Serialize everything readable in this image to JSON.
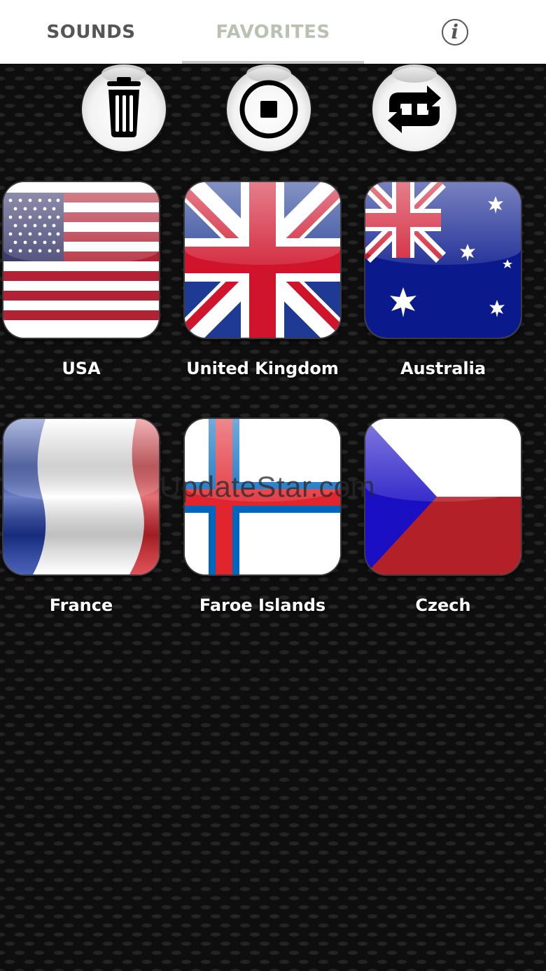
{
  "tabs": {
    "sounds": "SOUNDS",
    "favorites": "FAVORITES",
    "info_glyph": "i"
  },
  "controls": [
    {
      "name": "clear-favorites",
      "icon": "trash-icon"
    },
    {
      "name": "stop",
      "icon": "stop-icon"
    },
    {
      "name": "repeat",
      "icon": "repeat-icon"
    }
  ],
  "flags": [
    {
      "label": "USA",
      "icon": "usa-flag-icon"
    },
    {
      "label": "United Kingdom",
      "icon": "uk-flag-icon"
    },
    {
      "label": "Australia",
      "icon": "australia-flag-icon"
    },
    {
      "label": "France",
      "icon": "france-flag-icon"
    },
    {
      "label": "Faroe Islands",
      "icon": "faroe-islands-flag-icon"
    },
    {
      "label": "Czech",
      "icon": "czech-flag-icon"
    }
  ],
  "watermark": "UpdateStar.com",
  "colors": {
    "tab_active": "#555555",
    "tab_inactive": "#b9c2b1",
    "background": "#0e0e0e"
  }
}
